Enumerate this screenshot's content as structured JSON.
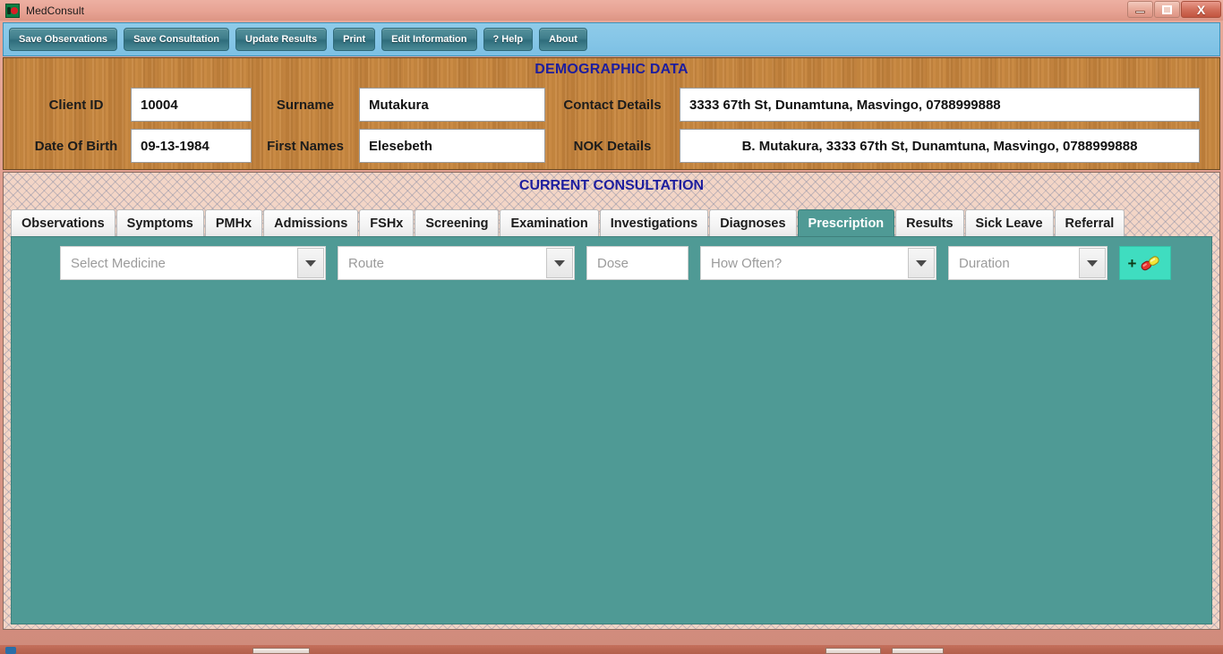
{
  "window": {
    "title": "MedConsult",
    "icon": "app-icon",
    "controls": {
      "minimize": "minimize-icon",
      "maximize": "maximize-icon",
      "close": "X"
    }
  },
  "toolbar": {
    "buttons": [
      {
        "label": "Save Observations",
        "name": "save-observations-button"
      },
      {
        "label": "Save Consultation",
        "name": "save-consultation-button"
      },
      {
        "label": "Update Results",
        "name": "update-results-button"
      },
      {
        "label": "Print",
        "name": "print-button"
      },
      {
        "label": "Edit Information",
        "name": "edit-information-button"
      },
      {
        "label": "? Help",
        "name": "help-button"
      },
      {
        "label": "About",
        "name": "about-button"
      }
    ]
  },
  "demographics": {
    "title": "DEMOGRAPHIC DATA",
    "fields": {
      "client_id_label": "Client ID",
      "client_id_value": "10004",
      "surname_label": "Surname",
      "surname_value": "Mutakura",
      "contact_label": "Contact Details",
      "contact_value": "3333 67th St, Dunamtuna, Masvingo, 0788999888",
      "dob_label": "Date Of Birth",
      "dob_value": "09-13-1984",
      "first_names_label": "First Names",
      "first_names_value": "Elesebeth",
      "nok_label": "NOK Details",
      "nok_value": "B. Mutakura, 3333 67th St, Dunamtuna, Masvingo, 0788999888"
    }
  },
  "consultation": {
    "title": "CURRENT CONSULTATION",
    "tabs": [
      {
        "label": "Observations",
        "name": "tab-observations",
        "active": false
      },
      {
        "label": "Symptoms",
        "name": "tab-symptoms",
        "active": false
      },
      {
        "label": "PMHx",
        "name": "tab-pmhx",
        "active": false
      },
      {
        "label": "Admissions",
        "name": "tab-admissions",
        "active": false
      },
      {
        "label": "FSHx",
        "name": "tab-fshx",
        "active": false
      },
      {
        "label": "Screening",
        "name": "tab-screening",
        "active": false
      },
      {
        "label": "Examination",
        "name": "tab-examination",
        "active": false
      },
      {
        "label": "Investigations",
        "name": "tab-investigations",
        "active": false
      },
      {
        "label": "Diagnoses",
        "name": "tab-diagnoses",
        "active": false
      },
      {
        "label": "Prescription",
        "name": "tab-prescription",
        "active": true
      },
      {
        "label": "Results",
        "name": "tab-results",
        "active": false
      },
      {
        "label": "Sick Leave",
        "name": "tab-sick-leave",
        "active": false
      },
      {
        "label": "Referral",
        "name": "tab-referral",
        "active": false
      }
    ],
    "prescription": {
      "medicine_placeholder": "Select Medicine",
      "route_placeholder": "Route",
      "dose_placeholder": "Dose",
      "frequency_placeholder": "How Often?",
      "duration_placeholder": "Duration",
      "add_plus": "+",
      "add_icon": "pill-capsule-icon"
    }
  },
  "colors": {
    "window_frame": "#dd9a8a",
    "toolbar_bg": "#86c6e7",
    "toolbar_button": "#3f7d8b",
    "demographic_wood": "#c8873f",
    "heading_blue": "#1d1d9e",
    "tab_active": "#4f9a95",
    "tab_body": "#4f9a95",
    "add_button": "#3fddc0"
  }
}
